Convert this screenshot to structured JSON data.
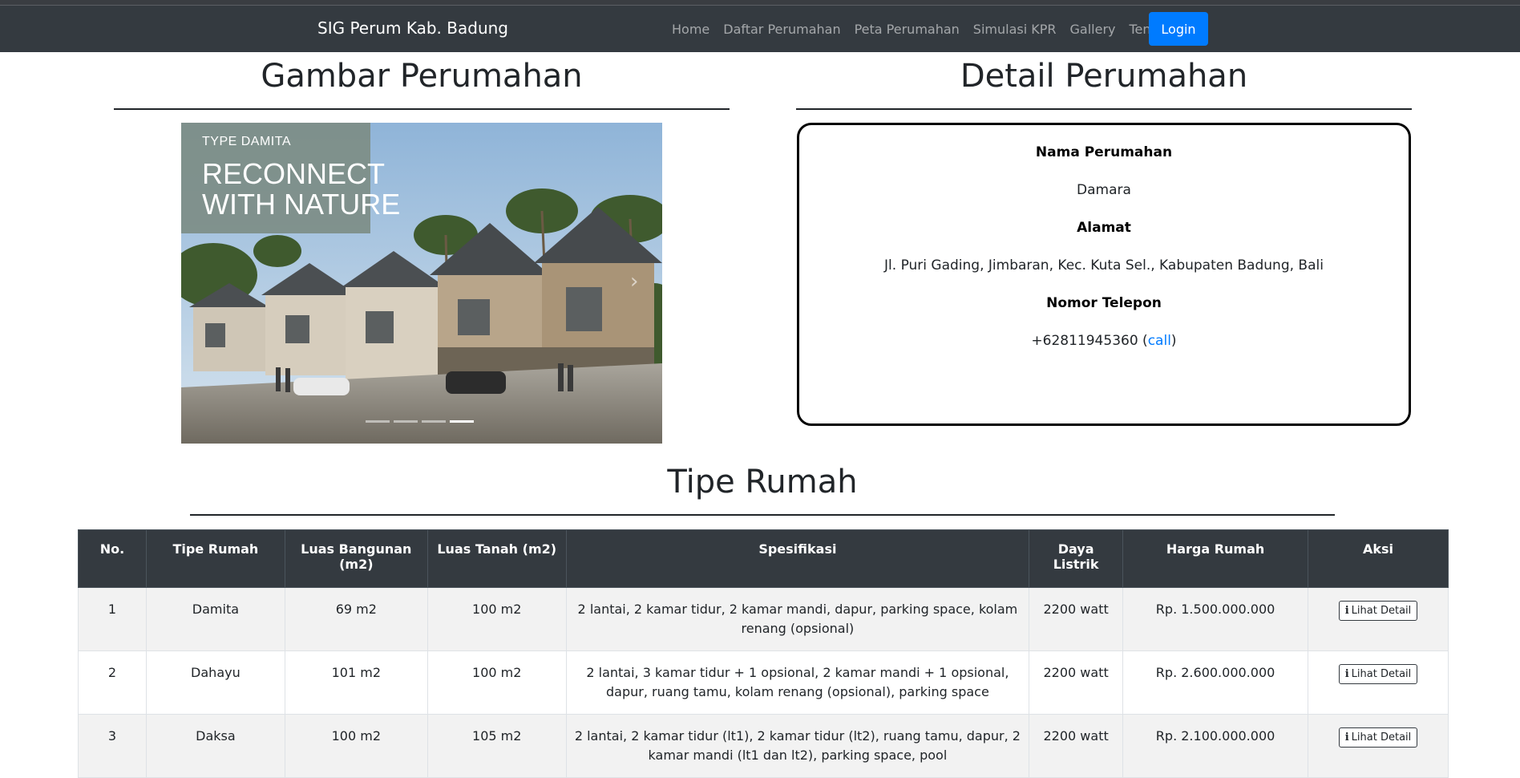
{
  "navbar": {
    "brand": "SIG Perum Kab. Badung",
    "links": [
      "Home",
      "Daftar Perumahan",
      "Peta Perumahan",
      "Simulasi KPR",
      "Gallery",
      "Tentang"
    ],
    "login_label": "Login"
  },
  "gallery": {
    "title": "Gambar Perumahan",
    "image_caption_small": "TYPE DAMITA",
    "image_caption_line1": "RECONNECT",
    "image_caption_line2": "WITH NATURE",
    "slide_count": 4,
    "active_slide": 4
  },
  "detail": {
    "title": "Detail Perumahan",
    "name_label": "Nama Perumahan",
    "name_value": "Damara",
    "address_label": "Alamat",
    "address_value": "Jl. Puri Gading, Jimbaran, Kec. Kuta Sel., Kabupaten Badung, Bali",
    "phone_label": "Nomor Telepon",
    "phone_value": "+62811945360",
    "call_link": "call"
  },
  "types": {
    "title": "Tipe Rumah",
    "headers": [
      "No.",
      "Tipe Rumah",
      "Luas Bangunan (m2)",
      "Luas Tanah (m2)",
      "Spesifikasi",
      "Daya Listrik",
      "Harga Rumah",
      "Aksi"
    ],
    "action_label": "Lihat Detail",
    "rows": [
      {
        "no": "1",
        "type": "Damita",
        "building": "69 m2",
        "land": "100 m2",
        "spec": "2 lantai, 2 kamar tidur, 2 kamar mandi, dapur, parking space, kolam renang (opsional)",
        "power": "2200 watt",
        "price": "Rp. 1.500.000.000"
      },
      {
        "no": "2",
        "type": "Dahayu",
        "building": "101 m2",
        "land": "100 m2",
        "spec": "2 lantai, 3 kamar tidur + 1 opsional, 2 kamar mandi + 1 opsional, dapur, ruang tamu, kolam renang (opsional), parking space",
        "power": "2200 watt",
        "price": "Rp. 2.600.000.000"
      },
      {
        "no": "3",
        "type": "Daksa",
        "building": "100 m2",
        "land": "105 m2",
        "spec": "2 lantai, 2 kamar tidur (lt1), 2 kamar tidur (lt2), ruang tamu, dapur, 2 kamar mandi (lt1 dan lt2), parking space, pool",
        "power": "2200 watt",
        "price": "Rp. 2.100.000.000"
      }
    ]
  }
}
